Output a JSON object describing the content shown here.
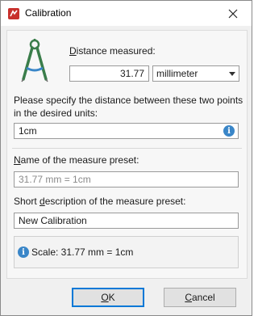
{
  "window": {
    "title": "Calibration"
  },
  "distance": {
    "label_prefix": "",
    "label_accel": "D",
    "label_rest": "istance measured:",
    "value": "31.77",
    "unit": "millimeter"
  },
  "specify": {
    "label": "Please specify the distance between these two points in the desired units:",
    "value": "1cm"
  },
  "preset_name": {
    "label_accel": "N",
    "label_rest": "ame of the measure preset:",
    "placeholder": "31.77 mm = 1cm"
  },
  "preset_desc": {
    "label_prefix": "Short ",
    "label_accel": "d",
    "label_rest": "escription of the measure preset:",
    "value": "New Calibration"
  },
  "scale": {
    "text": "Scale: 31.77 mm = 1cm"
  },
  "buttons": {
    "ok_accel": "O",
    "ok_rest": "K",
    "cancel_accel": "C",
    "cancel_rest": "ancel"
  },
  "colors": {
    "accent": "#0078d7",
    "info": "#3a86c8",
    "app_red": "#c8302c"
  }
}
